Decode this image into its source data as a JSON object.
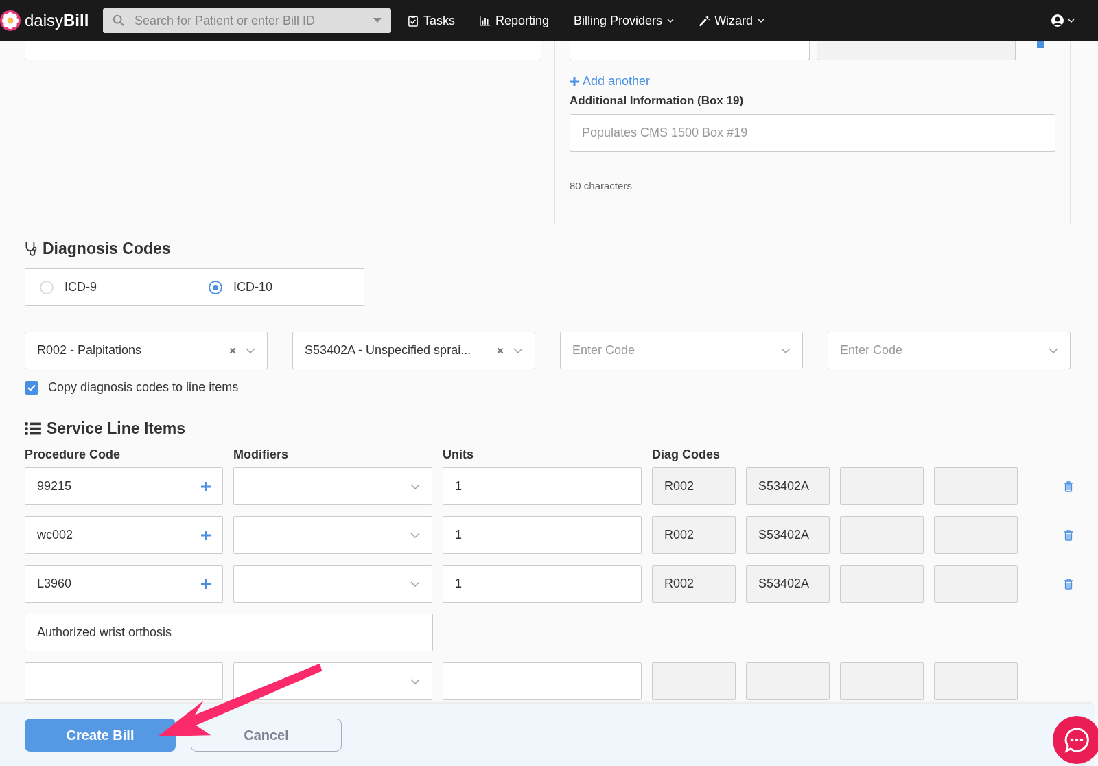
{
  "header": {
    "logo": "daisy**Bill**",
    "search": {
      "placeholder": "Search for Patient or enter Bill ID"
    },
    "nav": [
      {
        "label": "Tasks",
        "kind": "tasks"
      },
      {
        "label": "Reporting",
        "kind": "reporting"
      },
      {
        "label": "Billing Providers",
        "kind": "menu"
      },
      {
        "label": "Wizard",
        "kind": "wizard"
      }
    ]
  },
  "referral": {
    "add_another": "Add another",
    "additional_info": {
      "label": "Additional Information (Box 19)",
      "placeholder": "Populates CMS 1500 Box #19",
      "counter": "80 characters"
    }
  },
  "diagnosis": {
    "title": "Diagnosis Codes",
    "code_sets": [
      {
        "label": "ICD-9",
        "selected": false
      },
      {
        "label": "ICD-10",
        "selected": true
      }
    ],
    "codes": [
      {
        "value": "R002 - Palpitations"
      },
      {
        "value": "S53402A - Unspecified sprai..."
      },
      {
        "placeholder": "Enter Code"
      },
      {
        "placeholder": "Enter Code"
      }
    ],
    "copy_to_line_items": {
      "label": "Copy diagnosis codes to line items",
      "checked": true
    }
  },
  "service_lines": {
    "title": "Service Line Items",
    "columns": [
      "Procedure Code",
      "Modifiers",
      "Units",
      "Diag Codes"
    ],
    "rows": [
      {
        "kind": "line",
        "procedure": "99215",
        "units": "1",
        "diag_codes": [
          "R002",
          "S53402A"
        ]
      },
      {
        "kind": "line",
        "procedure": "wc002",
        "units": "1",
        "diag_codes": [
          "R002",
          "S53402A"
        ]
      },
      {
        "kind": "line",
        "procedure": "L3960",
        "units": "1",
        "diag_codes": [
          "R002",
          "S53402A"
        ]
      },
      {
        "kind": "note",
        "text": "Authorized wrist orthosis"
      },
      {
        "kind": "blank"
      }
    ]
  },
  "footer": {
    "buttons": [
      {
        "label": "Create Bill",
        "kind": "primary"
      },
      {
        "label": "Cancel",
        "kind": "secondary"
      }
    ]
  }
}
